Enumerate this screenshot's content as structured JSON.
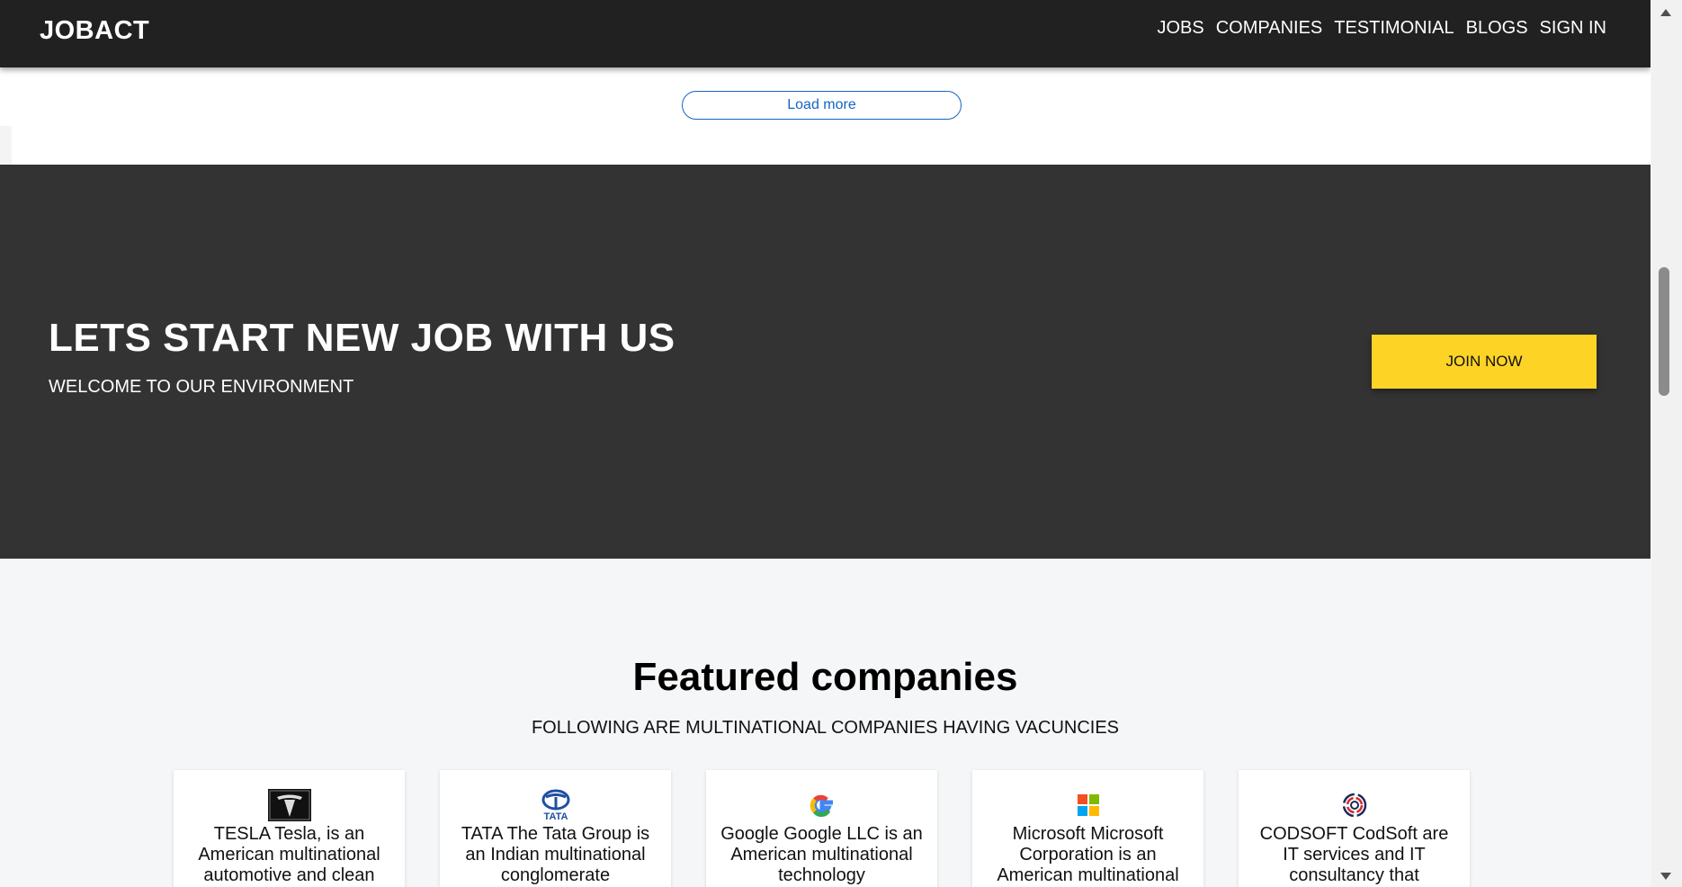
{
  "navbar": {
    "brand": "JOBACT",
    "links": [
      "JOBS",
      "COMPANIES",
      "TESTIMONIAL",
      "BLOGS",
      "SIGN IN"
    ]
  },
  "load_more_label": "Load more",
  "hero": {
    "title": "LETS START NEW JOB WITH US",
    "subtitle": "WELCOME TO OUR ENVIRONMENT",
    "join_label": "JOIN NOW"
  },
  "featured": {
    "title": "Featured companies",
    "subtitle": "FOLLOWING ARE MULTINATIONAL COMPANIES HAVING VACUNCIES",
    "companies": [
      {
        "logo": "tesla-logo",
        "text": "TESLA Tesla, is an American multinational automotive and clean"
      },
      {
        "logo": "tata-logo",
        "text": "TATA The Tata Group is an Indian multinational conglomerate"
      },
      {
        "logo": "google-logo",
        "text": "Google Google LLC is an American multinational technology"
      },
      {
        "logo": "microsoft-logo",
        "text": "Microsoft Microsoft Corporation is an American multinational"
      },
      {
        "logo": "codsoft-logo",
        "text": "CODSOFT CodSoft are IT services and IT consultancy that"
      }
    ]
  },
  "colors": {
    "navbar": "#212121",
    "hero": "#333333",
    "accent_yellow": "#fdd426",
    "link_blue": "#1565c0"
  }
}
